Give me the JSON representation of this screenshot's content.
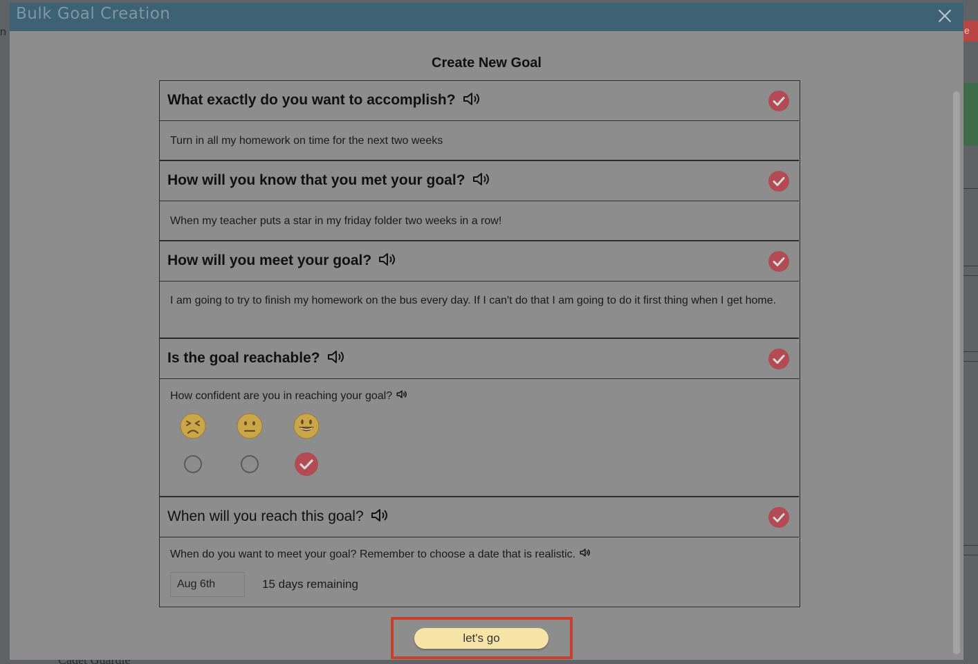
{
  "modal": {
    "title": "Bulk Goal Creation",
    "form_title": "Create New Goal"
  },
  "questions": [
    {
      "label": "What exactly do you want to accomplish?",
      "answer": "Turn in all my homework on time for the next two weeks",
      "completed": true
    },
    {
      "label": "How will you know that you met your goal?",
      "answer": "When my teacher puts a star in my friday folder two weeks in a row!",
      "completed": true
    },
    {
      "label": "How will you meet your goal?",
      "answer": "I am going to try to finish my homework on the bus every day. If I can't do that I am going to do it first thing when I get home.",
      "completed": true
    },
    {
      "label": "Is the goal reachable?",
      "sub_question": "How confident are you in reaching your goal?",
      "options": [
        "not-confident",
        "neutral",
        "confident"
      ],
      "selected": "confident",
      "completed": true
    },
    {
      "label": "When will you reach this goal?",
      "sub_question": "When do you want to meet your goal? Remember to choose a date that is realistic.",
      "date_value": "Aug 6th",
      "days_remaining": "15 days remaining",
      "completed": true
    }
  ],
  "submit_label": "let's go",
  "icons": {
    "speaker": "speaker-icon",
    "check": "check-circle-icon",
    "close": "close-icon"
  },
  "colors": {
    "header": "#3e6173",
    "check": "#b24b54",
    "submit": "#f6e4a6",
    "highlight": "#c8402b"
  }
}
